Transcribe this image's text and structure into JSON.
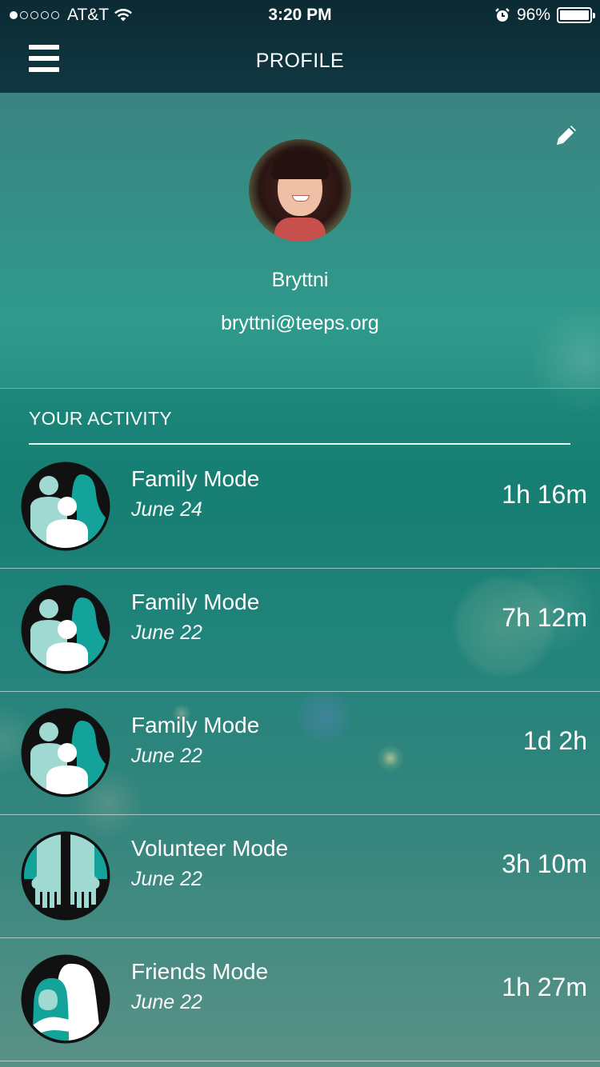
{
  "status_bar": {
    "carrier": "AT&T",
    "time": "3:20 PM",
    "battery": "96%",
    "battery_level": 0.96
  },
  "nav": {
    "title": "PROFILE",
    "menu_icon": "hamburger-menu-icon"
  },
  "profile": {
    "name": "Bryttni",
    "email": "bryttni@teeps.org",
    "edit_icon": "pencil-icon"
  },
  "activity": {
    "title": "YOUR ACTIVITY",
    "items": [
      {
        "mode": "Family Mode",
        "date": "June 24",
        "duration": "1h 16m",
        "icon": "family-icon"
      },
      {
        "mode": "Family Mode",
        "date": "June 22",
        "duration": "7h 12m",
        "icon": "family-icon"
      },
      {
        "mode": "Family Mode",
        "date": "June 22",
        "duration": "1d 2h",
        "icon": "family-icon"
      },
      {
        "mode": "Volunteer Mode",
        "date": "June 22",
        "duration": "3h 10m",
        "icon": "volunteer-hands-icon"
      },
      {
        "mode": "Friends Mode",
        "date": "June 22",
        "duration": "1h 27m",
        "icon": "friends-icon"
      }
    ]
  },
  "colors": {
    "topbar": "#0c2a33",
    "teal_accent": "#14a39a",
    "icon_light": "#9fd9d2",
    "icon_dark": "#111111"
  }
}
